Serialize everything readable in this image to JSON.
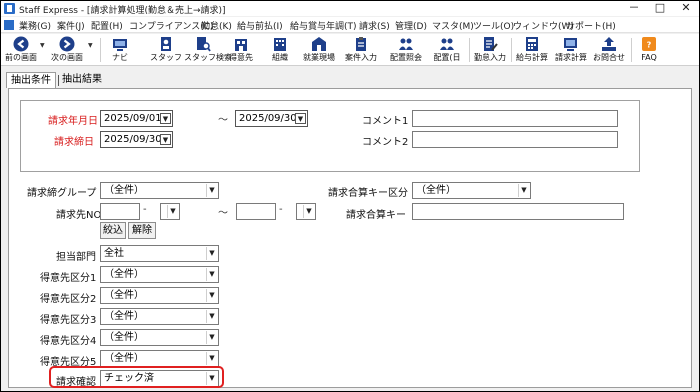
{
  "window": {
    "title": "Staff Express - [請求計算処理(勤怠＆売上→請求)]",
    "minimize": "－",
    "maximize": "□",
    "close": "✕"
  },
  "menu": [
    {
      "label": "業務(G)"
    },
    {
      "label": "案件(J)"
    },
    {
      "label": "配置(H)"
    },
    {
      "label": "コンプライアンス(C)"
    },
    {
      "label": "勤怠(K)"
    },
    {
      "label": "給与前払(I)"
    },
    {
      "label": "給与賞与年調(T)"
    },
    {
      "label": "請求(S)"
    },
    {
      "label": "管理(D)"
    },
    {
      "label": "マスタ(M)"
    },
    {
      "label": "ツール(O)"
    },
    {
      "label": "ウィンドウ(W)"
    },
    {
      "label": "サポート(H)"
    }
  ],
  "toolbar": [
    {
      "label": "前の画面",
      "icon": "back-arrow-icon"
    },
    {
      "label": "次の画面",
      "icon": "forward-arrow-icon"
    },
    {
      "label": "ナビ",
      "icon": "navi-icon"
    },
    {
      "label": "スタッフ",
      "icon": "staff-icon"
    },
    {
      "label": "スタッフ検索",
      "icon": "staff-search-icon"
    },
    {
      "label": "得意先",
      "icon": "customer-icon"
    },
    {
      "label": "組織",
      "icon": "organization-icon"
    },
    {
      "label": "就業現場",
      "icon": "workplace-icon"
    },
    {
      "label": "案件入力",
      "icon": "job-entry-icon"
    },
    {
      "label": "配置照会",
      "icon": "placement-inquiry-icon"
    },
    {
      "label": "配置(日",
      "icon": "placement-daily-icon"
    },
    {
      "label": "勤怠入力",
      "icon": "attendance-entry-icon"
    },
    {
      "label": "給与計算",
      "icon": "payroll-calc-icon"
    },
    {
      "label": "請求計算",
      "icon": "billing-calc-icon"
    },
    {
      "label": "お問合せ",
      "icon": "inquiry-icon"
    },
    {
      "label": "FAQ",
      "icon": "faq-icon"
    }
  ],
  "tabs": [
    {
      "label": "抽出条件",
      "active": true
    },
    {
      "label": "抽出結果",
      "active": false
    }
  ],
  "form": {
    "billing_month_label": "請求年月日",
    "billing_month_from": "2025/09/01",
    "range_sep": "～",
    "billing_month_to": "2025/09/30",
    "billing_close_label": "請求締日",
    "billing_close_date": "2025/09/30",
    "comment1_label": "コメント1",
    "comment2_label": "コメント2",
    "close_group_label": "請求締グループ",
    "close_group_value": "（全件）",
    "merge_key_class_label": "請求合算キー区分",
    "merge_key_class_value": "（全件）",
    "billto_no_label": "請求先NO",
    "billto_no_sep": "～",
    "merge_key_label": "請求合算キー",
    "narrow_button": "絞込",
    "clear_button": "解除",
    "dept_label": "担当部門",
    "dept_value": "全社",
    "customer_class1_label": "得意先区分1",
    "customer_class1_value": "（全件）",
    "customer_class2_label": "得意先区分2",
    "customer_class2_value": "（全件）",
    "customer_class3_label": "得意先区分3",
    "customer_class3_value": "（全件）",
    "customer_class4_label": "得意先区分4",
    "customer_class4_value": "（全件）",
    "customer_class5_label": "得意先区分5",
    "customer_class5_value": "（全件）",
    "billing_confirm_label": "請求確認",
    "billing_confirm_value": "チェック済"
  },
  "colors": {
    "required_label": "#d81e1e",
    "highlight": "#e02020"
  }
}
